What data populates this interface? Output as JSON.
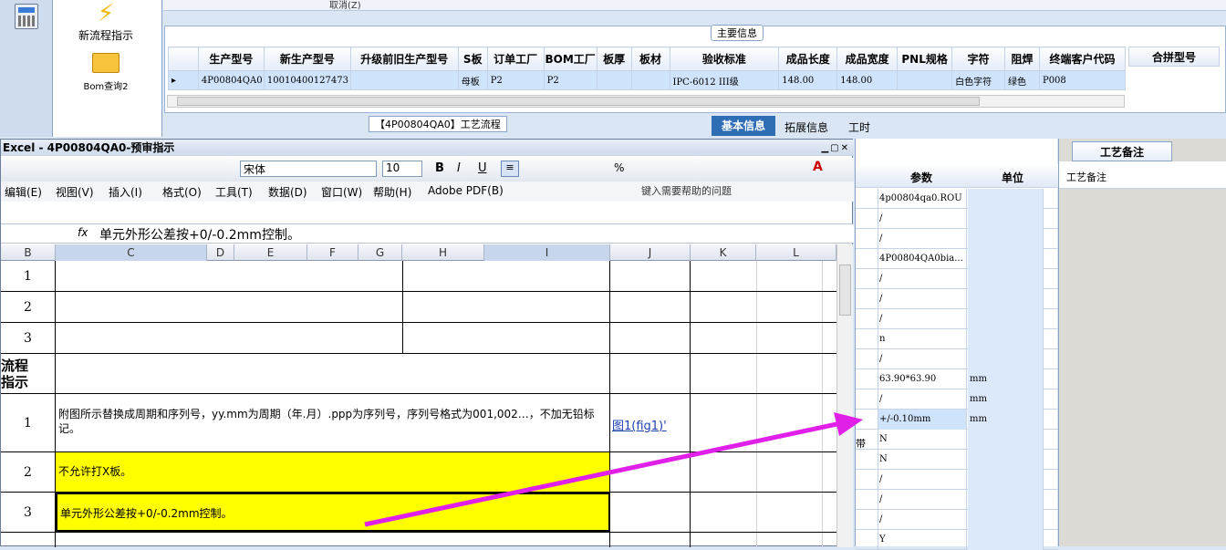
{
  "nav": {
    "new_flow": "新流程指示",
    "bom_query": "Bom查询2"
  },
  "topbar": {
    "cancel": "取消(Z)"
  },
  "main_info": {
    "section_title": "主要信息",
    "headers": [
      "生产型号",
      "新生产型号",
      "升级前旧生产型号",
      "S板",
      "订单工厂",
      "BOM工厂",
      "板厚",
      "板材",
      "验收标准",
      "成品长度",
      "成品宽度",
      "PNL规格",
      "字符",
      "阻焊",
      "终端客户代码"
    ],
    "extra_header": "合拼型号",
    "row": [
      "4P00804QA0",
      "10010400127473",
      "",
      "母板",
      "P2",
      "P2",
      "",
      "",
      "IPC-6012 III级",
      "148.00",
      "148.00",
      "",
      "白色字符",
      "绿色",
      "P008"
    ]
  },
  "tabs": {
    "process_flow": "【4P00804QA0】工艺流程",
    "basic_info": "基本信息",
    "ext_info": "拓展信息",
    "work_hours": "工时"
  },
  "excel": {
    "title": "Excel - 4P00804QA0-预审指示",
    "font_name": "宋体",
    "font_size": "10",
    "menus": [
      "编辑(E)",
      "视图(V)",
      "插入(I)",
      "格式(O)",
      "工具(T)",
      "数据(D)",
      "窗口(W)",
      "帮助(H)",
      "Adobe PDF(B)"
    ],
    "help_placeholder": "键入需要帮助的问题",
    "formula": "单元外形公差按+0/-0.2mm控制。",
    "fx": "fx",
    "columns": [
      "B",
      "C",
      "D",
      "E",
      "F",
      "G",
      "H",
      "I",
      "J",
      "K",
      "L"
    ],
    "rows": [
      {
        "b": "1",
        "text": "",
        "link": ""
      },
      {
        "b": "2",
        "text": "",
        "link": ""
      },
      {
        "b": "3",
        "text": "",
        "link": ""
      },
      {
        "b": "流程\n指示",
        "text": "",
        "link": ""
      },
      {
        "b": "1",
        "text": "附图所示替换成周期和序列号，yy.mm为周期（年.月）.ppp为序列号，序列号格式为001,002…，不加无铅标记。",
        "link": "图1(fig1)'"
      },
      {
        "b": "2",
        "text": "不允许打X板。",
        "link": ""
      },
      {
        "b": "3",
        "text": "单元外形公差按+0/-0.2mm控制。",
        "link": ""
      }
    ]
  },
  "params": {
    "header_param": "参数",
    "header_unit": "单位",
    "rows": [
      {
        "p": "4p00804qa0.ROU",
        "u": ""
      },
      {
        "p": "/",
        "u": ""
      },
      {
        "p": "/",
        "u": ""
      },
      {
        "p": "4P00804QA0bia...",
        "u": ""
      },
      {
        "p": "/",
        "u": ""
      },
      {
        "p": "/",
        "u": ""
      },
      {
        "p": "/",
        "u": ""
      },
      {
        "p": "n",
        "u": ""
      },
      {
        "p": "/",
        "u": ""
      },
      {
        "p": "63.90*63.90",
        "u": "mm"
      },
      {
        "p": "/",
        "u": "mm"
      },
      {
        "p": "+/-0.10mm",
        "u": "mm"
      },
      {
        "p": "N",
        "u": ""
      },
      {
        "p": "N",
        "u": ""
      },
      {
        "p": "/",
        "u": ""
      },
      {
        "p": "/",
        "u": ""
      },
      {
        "p": "/",
        "u": ""
      },
      {
        "p": "Y",
        "u": ""
      }
    ],
    "side_label": "带"
  },
  "remarks": {
    "tab": "工艺备注",
    "label": "工艺备注"
  }
}
